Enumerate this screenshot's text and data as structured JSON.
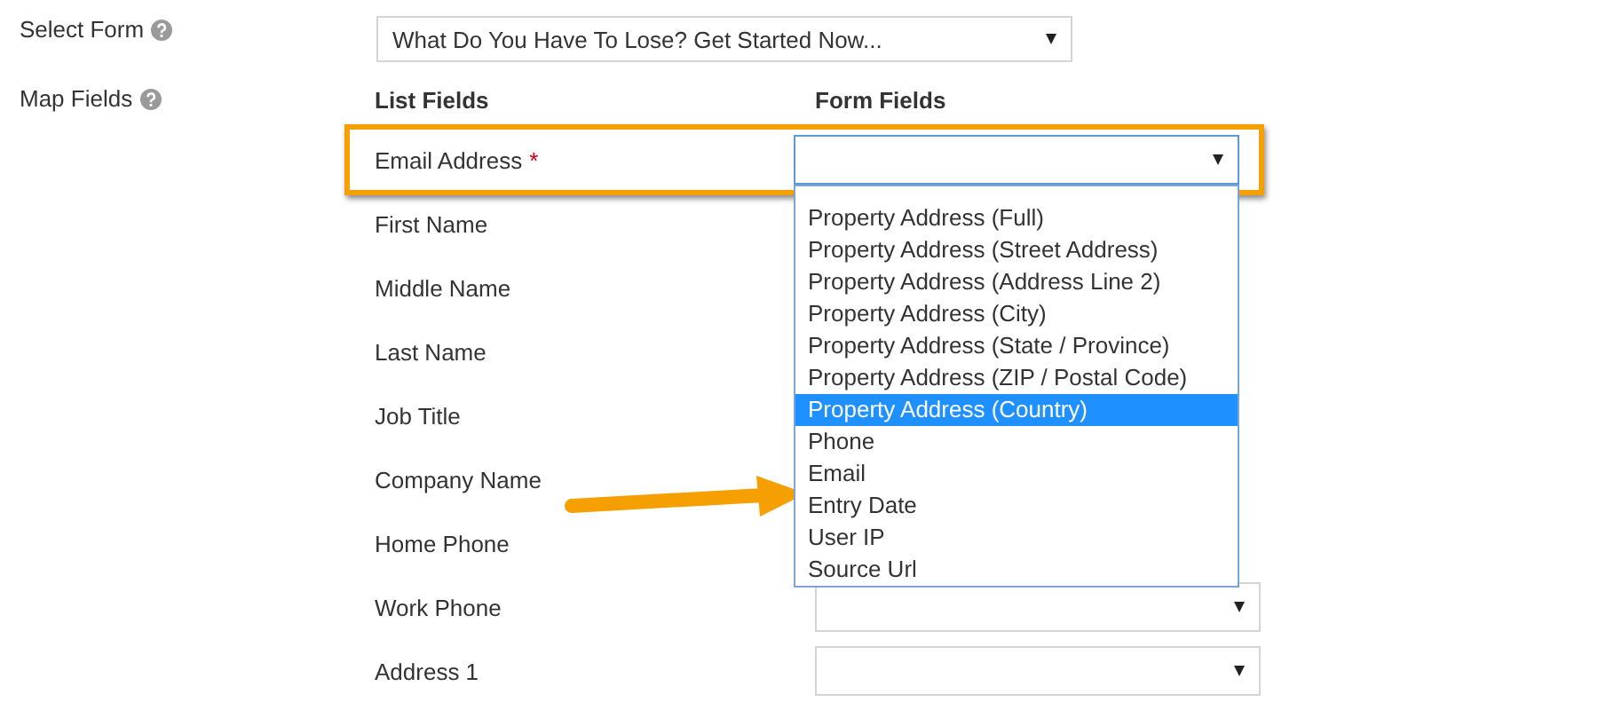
{
  "select_form": {
    "label": "Select Form",
    "value": "What Do You Have To Lose? Get Started Now..."
  },
  "map_fields": {
    "label": "Map Fields",
    "columns": [
      "List Fields",
      "Form Fields"
    ],
    "rows": [
      {
        "name": "Email Address",
        "required_mark": "*",
        "highlighted": true,
        "kind": "open"
      },
      {
        "name": "First Name",
        "highlighted": false,
        "kind": "covered"
      },
      {
        "name": "Middle Name",
        "highlighted": false,
        "kind": "covered"
      },
      {
        "name": "Last Name",
        "highlighted": false,
        "kind": "covered"
      },
      {
        "name": "Job Title",
        "highlighted": false,
        "kind": "covered"
      },
      {
        "name": "Company Name",
        "highlighted": false,
        "kind": "covered"
      },
      {
        "name": "Home Phone",
        "highlighted": false,
        "kind": "covered"
      },
      {
        "name": "Work Phone",
        "highlighted": false,
        "kind": "select"
      },
      {
        "name": "Address 1",
        "highlighted": false,
        "kind": "select"
      }
    ]
  },
  "dropdown": {
    "options": [
      {
        "label": "Property Address (Full)",
        "selected": false
      },
      {
        "label": "Property Address (Street Address)",
        "selected": false
      },
      {
        "label": "Property Address (Address Line 2)",
        "selected": false
      },
      {
        "label": "Property Address (City)",
        "selected": false
      },
      {
        "label": "Property Address (State / Province)",
        "selected": false
      },
      {
        "label": "Property Address (ZIP / Postal Code)",
        "selected": false
      },
      {
        "label": "Property Address (Country)",
        "selected": true
      },
      {
        "label": "Phone",
        "selected": false
      },
      {
        "label": "Email",
        "selected": false
      },
      {
        "label": "Entry Date",
        "selected": false
      },
      {
        "label": "User IP",
        "selected": false
      },
      {
        "label": "Source Url",
        "selected": false
      }
    ]
  }
}
